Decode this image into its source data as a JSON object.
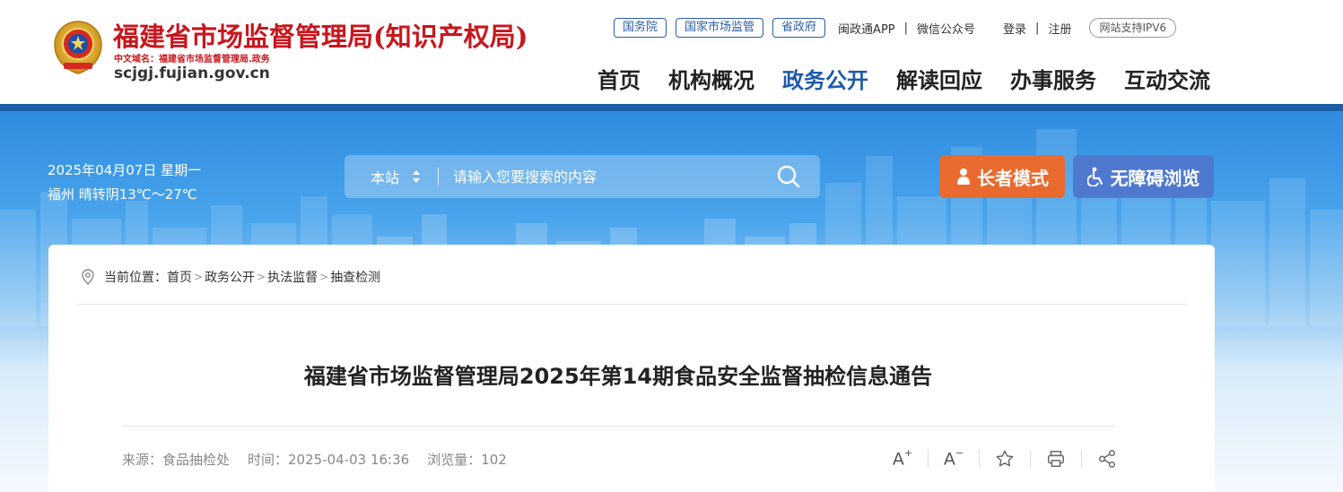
{
  "header": {
    "site_title": "福建省市场监督管理局(知识产权局)",
    "cn_domain": "中文域名：福建省市场监督管理局.政务",
    "en_domain": "scjgj.fujian.gov.cn",
    "top_pills": [
      "国务院",
      "国家市场监管",
      "省政府"
    ],
    "app_link": "闽政通APP",
    "wechat_link": "微信公众号",
    "login": "登录",
    "register": "注册",
    "ipv6": "网站支持IPV6",
    "separator": "|"
  },
  "nav": {
    "items": [
      "首页",
      "机构概况",
      "政务公开",
      "解读回应",
      "办事服务",
      "互动交流"
    ],
    "active": "政务公开"
  },
  "banner": {
    "date": "2025年04月07日 星期一",
    "weather": "福州 晴转阴13℃～27℃",
    "search_scope": "本站",
    "search_placeholder": "请输入您要搜索的内容",
    "elder_mode": "长者模式",
    "accessible": "无障碍浏览"
  },
  "breadcrumb": {
    "prefix": "当前位置：",
    "items": [
      "首页",
      "政务公开",
      "执法监督",
      "抽查检测"
    ],
    "sep": ">"
  },
  "article": {
    "title": "福建省市场监督管理局2025年第14期食品安全监督抽检信息通告",
    "source": "来源：食品抽检处",
    "time": "时间：2025-04-03 16:36",
    "views": "浏览量：102"
  },
  "tools": {
    "font_increase": "A",
    "font_increase_sign": "+",
    "font_decrease": "A",
    "font_decrease_sign": "−"
  },
  "colors": {
    "brand_red": "#c8161d",
    "nav_active": "#1d5aa8",
    "elder_btn": "#e86a2e",
    "access_btn": "#4f79cf"
  }
}
